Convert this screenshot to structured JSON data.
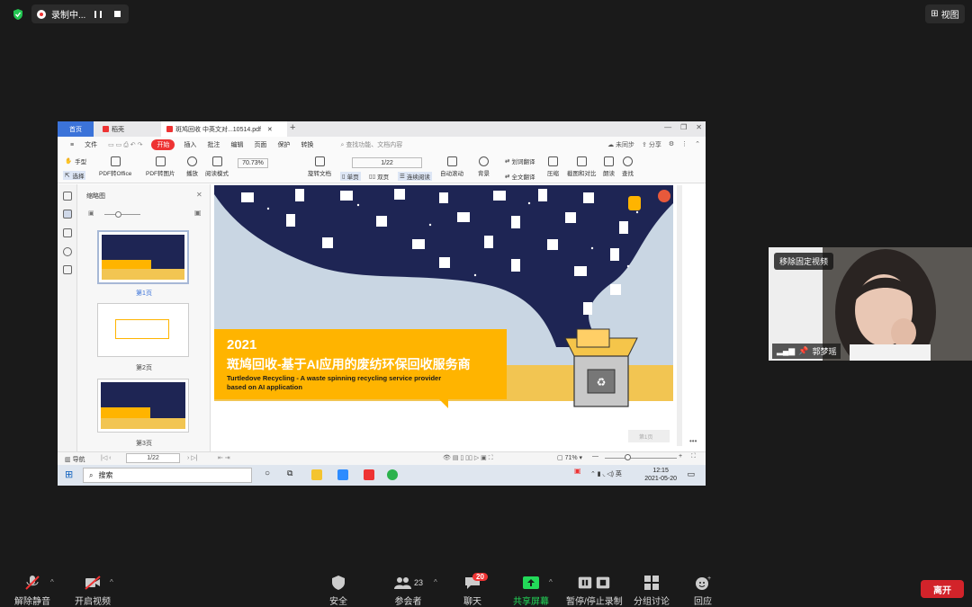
{
  "meeting_top": {
    "recording_label": "录制中...",
    "view_label": "视图"
  },
  "wps": {
    "tabs": [
      "首页",
      "稻壳",
      "斑鸠回收 中英文对...10514.pdf"
    ],
    "menu": [
      "文件",
      "开始",
      "插入",
      "批注",
      "编辑",
      "页面",
      "保护",
      "转换"
    ],
    "search_placeholder": "查找功能、文档内容",
    "menu_right": [
      "未同步",
      "分享"
    ],
    "toolbar": {
      "hand": "手型",
      "select": "选择",
      "pdf_office": "PDF转Office",
      "pdf_image": "PDF转图片",
      "play": "播放",
      "read_mode": "阅读模式",
      "zoom": "70.73%",
      "rotate": "旋转文档",
      "single": "单页",
      "double": "双页",
      "continuous": "连续阅读",
      "page": "1/22",
      "autoscroll": "自动滚动",
      "background": "背景",
      "translate": "划词翻译",
      "full_translate": "全文翻译",
      "compress": "压缩",
      "screenshot": "截图和对比",
      "read_aloud": "朗读",
      "find": "查找"
    },
    "sidebar": {
      "title": "缩略图",
      "thumb_labels": [
        "第1页",
        "第2页",
        "第3页"
      ]
    },
    "slide": {
      "year": "2021",
      "title_cn": "斑鸠回收-基于AI应用的废纺环保回收服务商",
      "title_en_1": "Turtledove Recycling - A waste spinning recycling service provider",
      "title_en_2": "based on AI application",
      "page_watermark": "第1页"
    },
    "status": {
      "nav": "导航",
      "page": "1/22",
      "zoom": "71%"
    }
  },
  "taskbar": {
    "search": "搜索",
    "time": "12:15",
    "date": "2021-05-20"
  },
  "video": {
    "unpin_label": "移除固定视频",
    "name": "郭梦瑶"
  },
  "controls": {
    "unmute": "解除静音",
    "start_video": "开启视频",
    "security": "安全",
    "participants": "参会者",
    "participants_count": "23",
    "chat": "聊天",
    "chat_badge": "20",
    "share": "共享屏幕",
    "record": "暂停/停止录制",
    "breakout": "分组讨论",
    "reactions": "回应",
    "leave": "离开"
  },
  "colors": {
    "wps_blue": "#3b73d9",
    "wps_red": "#e33333",
    "slide_navy": "#1e2554",
    "slide_yellow": "#ffb400",
    "share_green": "#23d959",
    "leave_red": "#d2232a"
  }
}
